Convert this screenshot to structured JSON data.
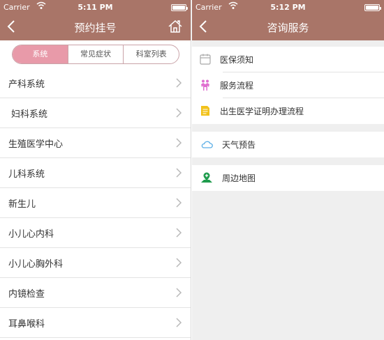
{
  "left": {
    "status": {
      "carrier": "Carrier",
      "time": "5:11 PM"
    },
    "title": "预约挂号",
    "segments": [
      "系统",
      "常见症状",
      "科室列表"
    ],
    "items": [
      "产科系统",
      "妇科系统",
      "生殖医学中心",
      "儿科系统",
      "新生儿",
      "小儿心内科",
      "小儿心胸外科",
      "内镜检查",
      "耳鼻喉科"
    ]
  },
  "right": {
    "status": {
      "carrier": "Carrier",
      "time": "5:12 PM"
    },
    "title": "咨询服务",
    "group1": [
      {
        "label": "医保须知",
        "icon": "calendar-icon"
      },
      {
        "label": "服务流程",
        "icon": "people-icon"
      },
      {
        "label": "出生医学证明办理流程",
        "icon": "document-icon"
      }
    ],
    "group2": [
      {
        "label": "天气预告",
        "icon": "cloud-icon"
      }
    ],
    "group3": [
      {
        "label": "周边地图",
        "icon": "map-pin-icon"
      }
    ]
  },
  "colors": {
    "header": "#a97568",
    "segment_active": "#e89aa9",
    "background": "#efefef"
  }
}
